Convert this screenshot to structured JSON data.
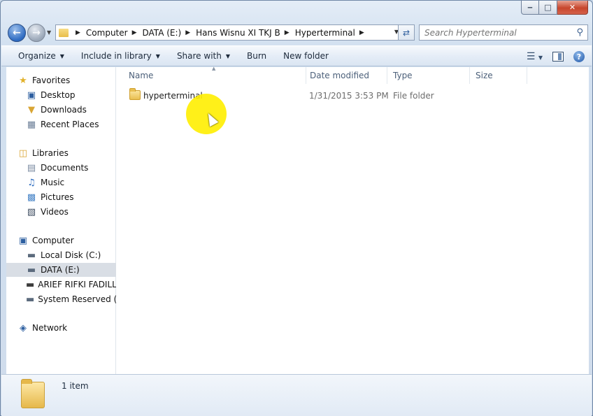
{
  "window": {
    "caption_buttons": {
      "minimize": "‒",
      "maximize": "□",
      "close": "✕"
    }
  },
  "address_bar": {
    "crumbs": [
      "Computer",
      "DATA (E:)",
      "Hans Wisnu XI TKJ B",
      "Hyperterminal"
    ]
  },
  "search": {
    "placeholder": "Search Hyperterminal"
  },
  "toolbar": {
    "organize": "Organize",
    "include_in_library": "Include in library",
    "share_with": "Share with",
    "burn": "Burn",
    "new_folder": "New folder"
  },
  "nav_pane": {
    "favorites": {
      "label": "Favorites",
      "items": [
        "Desktop",
        "Downloads",
        "Recent Places"
      ]
    },
    "libraries": {
      "label": "Libraries",
      "items": [
        "Documents",
        "Music",
        "Pictures",
        "Videos"
      ]
    },
    "computer": {
      "label": "Computer",
      "items": [
        "Local Disk (C:)",
        "DATA (E:)",
        "ARIEF RIFKI FADILLA",
        "System Reserved (Z:"
      ]
    },
    "network": {
      "label": "Network"
    },
    "selected": "DATA (E:)"
  },
  "columns": {
    "name": "Name",
    "date_modified": "Date modified",
    "type": "Type",
    "size": "Size"
  },
  "files": [
    {
      "name": "hyperterminal",
      "date_modified": "1/31/2015 3:53 PM",
      "type": "File folder",
      "size": ""
    }
  ],
  "status": {
    "item_count": "1 item"
  },
  "colors": {
    "accent": "#2e6bc2",
    "highlight": "#ffee00",
    "selection": "#d9dee5"
  }
}
